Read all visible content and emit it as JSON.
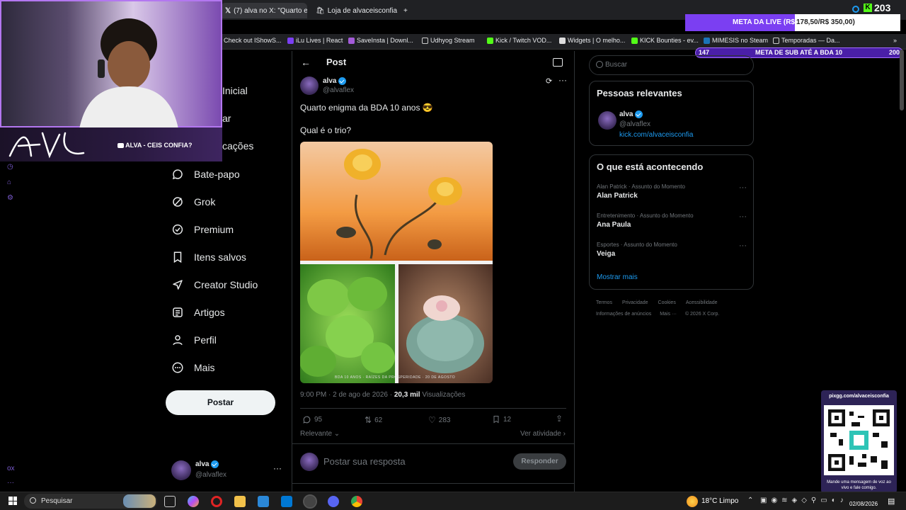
{
  "browser": {
    "tabs": [
      {
        "label": "(7) alva no X: \"Quarto enig",
        "active": true
      },
      {
        "label": "Loja de alvaceisconfia | O",
        "active": false
      }
    ],
    "bookmarks": [
      "Check out IShowS...",
      "iLu Lives | React",
      "SaveInsta | Downl...",
      "Udhyog Stream",
      "Kick / Twitch VOD...",
      "Widgets | O melho...",
      "KICK Bounties - ev...",
      "MIMESIS no Steam",
      "Temporadas — Da..."
    ]
  },
  "stream_overlay": {
    "webcam_tag": "ALVA - CEIS CONFIA?",
    "kick_count": "203",
    "meta_live_label": "META DA LIVE (R$",
    "meta_live_value": "178,50/R$ 350,00)",
    "meta_sub_left": "147",
    "meta_sub_label": "META DE SUB ATÉ A BDA 10",
    "meta_sub_right": "200",
    "qr_url": "pixgg.com/alvaceisconfia",
    "qr_caption": "Mande uma mensagem de voz ao vivo e fale comigo."
  },
  "nav": {
    "items": [
      {
        "label": "Página Inicial",
        "visible": "Inicial",
        "icon": "home-icon"
      },
      {
        "label": "Explorar",
        "visible": "ar",
        "icon": "search-icon"
      },
      {
        "label": "Notificações",
        "visible": "cações",
        "icon": "bell-icon"
      },
      {
        "label": "Bate-papo",
        "icon": "chat-icon"
      },
      {
        "label": "Grok",
        "icon": "grok-icon"
      },
      {
        "label": "Premium",
        "icon": "premium-icon"
      },
      {
        "label": "Itens salvos",
        "icon": "bookmark-icon"
      },
      {
        "label": "Creator Studio",
        "icon": "rocket-icon"
      },
      {
        "label": "Artigos",
        "icon": "article-icon"
      },
      {
        "label": "Perfil",
        "icon": "person-icon"
      },
      {
        "label": "Mais",
        "icon": "more-circle-icon"
      }
    ],
    "post_button": "Postar",
    "account_name": "alva",
    "account_handle": "@alvaflex"
  },
  "post": {
    "header_title": "Post",
    "author_name": "alva",
    "author_handle": "@alvaflex",
    "text_line1": "Quarto enigma da BDA 10 anos 😎",
    "text_line2": "Qual é o trio?",
    "image_caption": "BDA 10 ANOS  ·  RAÍZES DA PROSPERIDADE  ·  20 DE AGOSTO",
    "timestamp": "9:00 PM · 2 de ago de 2026 · ",
    "views_count": "20,3 mil",
    "views_label": "Visualizações",
    "replies": "95",
    "reposts": "62",
    "likes": "283",
    "bookmarks": "12",
    "sort_label": "Relevante",
    "activity_label": "Ver atividade",
    "reply_placeholder": "Postar sua resposta",
    "reply_button": "Responder"
  },
  "sidebar": {
    "search_placeholder": "Buscar",
    "relevant_title": "Pessoas relevantes",
    "relevant_name": "alva",
    "relevant_handle": "@alvaflex",
    "relevant_link": "kick.com/alvaceisconfia",
    "trends_title": "O que está acontecendo",
    "trends": [
      {
        "category": "Alan Patrick · Assunto do Momento",
        "name": "Alan Patrick"
      },
      {
        "category": "Entretenimento · Assunto do Momento",
        "name": "Ana Paula"
      },
      {
        "category": "Esportes · Assunto do Momento",
        "name": "Veiga"
      }
    ],
    "show_more": "Mostrar mais",
    "footer_line1": [
      "Termos",
      "Privacidade",
      "Cookies",
      "Acessibilidade"
    ],
    "footer_line2": [
      "Informações de anúncios",
      "Mais ···",
      "© 2026 X Corp."
    ]
  },
  "taskbar": {
    "search_placeholder": "Pesquisar",
    "weather_temp": "18°C",
    "weather_desc": "Limpo",
    "date": "02/08/2026"
  }
}
